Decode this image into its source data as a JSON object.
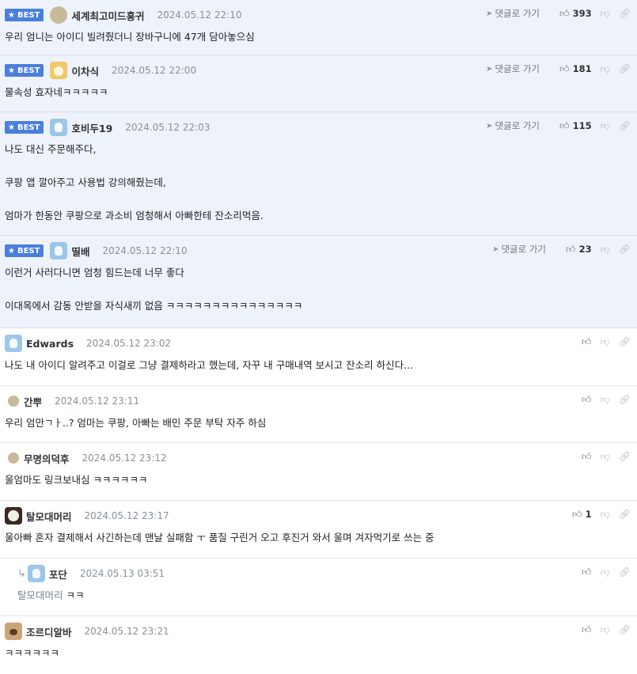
{
  "labels": {
    "best": "BEST",
    "goto": "댓글로 가기"
  },
  "comments": [
    {
      "nick": "세계최고미드흥귀",
      "date": "2024.05.12 22:10",
      "likes": "393",
      "text": "우리 엄니는 아이디 빌려줬더니 장바구니에 47개 담아놓으심"
    },
    {
      "nick": "이차식",
      "date": "2024.05.12 22:00",
      "likes": "181",
      "text": "물속성 효자네ㅋㅋㅋㅋㅋ"
    },
    {
      "nick": "호비두19",
      "date": "2024.05.12 22:03",
      "likes": "115",
      "text": "나도 대신 주문해주다,\n\n쿠팡 앱 깔아주고 사용법 강의해줬는데,\n\n엄마가 한동안 쿠팡으로 과소비 엄청해서 아빠한테 잔소리먹음."
    },
    {
      "nick": "띨배",
      "date": "2024.05.12 22:10",
      "likes": "23",
      "text": "이런거 사러다니면 엄청 힘드는데 너무 좋다\n\n이대목에서 감동 안받을 자식새끼 없음 ㅋㅋㅋㅋㅋㅋㅋㅋㅋㅋㅋㅋㅋㅋㅋ"
    },
    {
      "nick": "Edwards",
      "date": "2024.05.12 23:02",
      "likes": "",
      "text": "나도 내 아이디 알려주고 이걸로 그냥 결제하라고 했는데, 자꾸 내 구매내역 보시고 잔소리 하신다..."
    },
    {
      "nick": "간뿌",
      "date": "2024.05.12 23:11",
      "likes": "",
      "text": "우리 엄만ㄱㅏ..? 엄마는 쿠팡, 아빠는 배민 주문 부탁 자주 하심"
    },
    {
      "nick": "무명의덕후",
      "date": "2024.05.12 23:12",
      "likes": "",
      "text": "울엄마도 링크보내심 ㅋㅋㅋㅋㅋㅋ"
    },
    {
      "nick": "탈모대머리",
      "date": "2024.05.12 23:17",
      "likes": "1",
      "text": "울아빠 혼자 결제해서 사긴하는데 맨날 실패함 ㅜ 품질 구린거 오고 후진거 와서 울며 겨자먹기로 쓰는 중"
    },
    {
      "nick": "포단",
      "date": "2024.05.13 03:51",
      "likes": "",
      "mention": "탈모대머리",
      "text": "ㅋㅋ"
    },
    {
      "nick": "조르디알바",
      "date": "2024.05.12 23:21",
      "likes": "",
      "text": "ㅋㅋㅋㅋㅋㅋ"
    }
  ],
  "icons": {
    "like": "thumbs-up-icon",
    "dislike": "thumbs-down-icon",
    "share": "link-icon",
    "goto": "location-arrow-icon",
    "best": "star-icon"
  },
  "colors": {
    "best_bg": "#eef2fb",
    "badge": "#4a7fdc"
  }
}
